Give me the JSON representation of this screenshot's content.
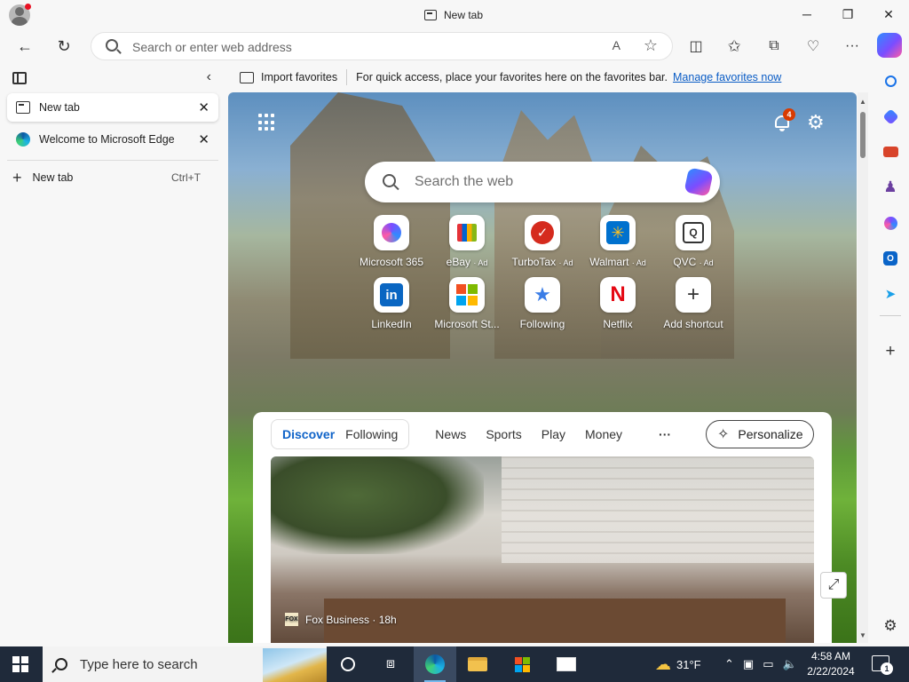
{
  "window": {
    "title": "New tab",
    "minimize": "─",
    "maximize": "❐",
    "close": "✕"
  },
  "toolbar": {
    "address_placeholder": "Search or enter web address",
    "read_aloud": "A",
    "favorite_star": "☆",
    "more": "···"
  },
  "vertical_tabs": {
    "tabs": [
      {
        "label": "New tab",
        "active": true
      },
      {
        "label": "Welcome to Microsoft Edge",
        "active": false
      }
    ],
    "new_tab_label": "New tab",
    "new_tab_shortcut": "Ctrl+T"
  },
  "favorites_bar": {
    "import_label": "Import favorites",
    "message": "For quick access, place your favorites here on the favorites bar.",
    "manage_link": "Manage favorites now"
  },
  "new_tab_page": {
    "notification_count": "4",
    "search_placeholder": "Search the web",
    "shortcuts": [
      {
        "label": "Microsoft 365",
        "ad": ""
      },
      {
        "label": "eBay",
        "ad": "· Ad"
      },
      {
        "label": "TurboTax",
        "ad": "· Ad"
      },
      {
        "label": "Walmart",
        "ad": "· Ad"
      },
      {
        "label": "QVC",
        "ad": "· Ad"
      },
      {
        "label": "LinkedIn",
        "ad": ""
      },
      {
        "label": "Microsoft St...",
        "ad": ""
      },
      {
        "label": "Following",
        "ad": ""
      },
      {
        "label": "Netflix",
        "ad": ""
      },
      {
        "label": "Add shortcut",
        "ad": ""
      }
    ],
    "feed_tabs": {
      "pill": [
        "Discover",
        "Following"
      ],
      "others": [
        "News",
        "Sports",
        "Play",
        "Money"
      ],
      "more": "···"
    },
    "personalize_label": "Personalize",
    "hero_source": "Fox Business · 18h",
    "hero_source_logo": "FOX"
  },
  "taskbar": {
    "search_placeholder": "Type here to search",
    "weather_temp": "31°F",
    "time": "4:58 AM",
    "date": "2/22/2024",
    "notification_count": "1"
  },
  "colors": {
    "accent_link": "#0a5cc5",
    "feed_active": "#0f63c8",
    "badge": "#d83b01",
    "taskbar": "#1f2a3a"
  }
}
